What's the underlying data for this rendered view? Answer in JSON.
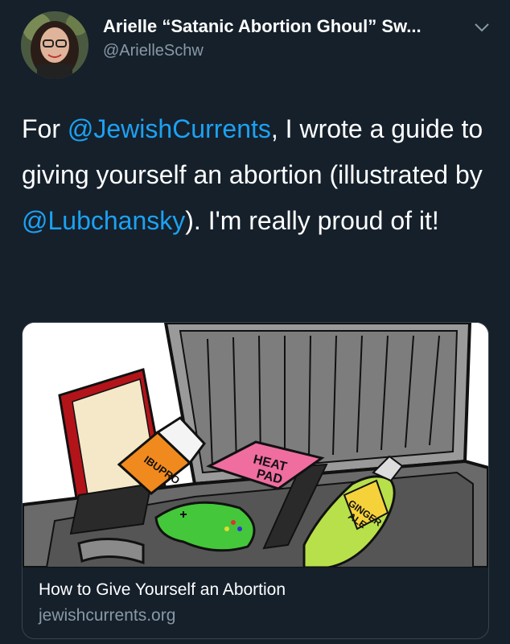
{
  "author": {
    "name": "Arielle “Satanic Abortion Ghoul” Sw...",
    "handle": "@ArielleSchw"
  },
  "tweet": {
    "part1": "For ",
    "mention1": "@JewishCurrents",
    "part2": ", I wrote a guide to giving yourself an abortion (illustrated by ",
    "mention2": "@Lubchansky",
    "part3": "). I'm really proud of it!"
  },
  "card": {
    "illustration": {
      "bottle_label": "IBUPRO",
      "heat_pad_line1": "HEAT",
      "heat_pad_line2": "PAD",
      "ale_line1": "GINGER",
      "ale_line2": "ALE"
    },
    "title": "How to Give Yourself an Abortion",
    "domain": "jewishcurrents.org"
  },
  "colors": {
    "background": "#15202b",
    "link": "#1da1f2",
    "secondary_text": "#8899a6",
    "border": "#38444d"
  },
  "icons": {
    "menu": "chevron-down-icon"
  }
}
